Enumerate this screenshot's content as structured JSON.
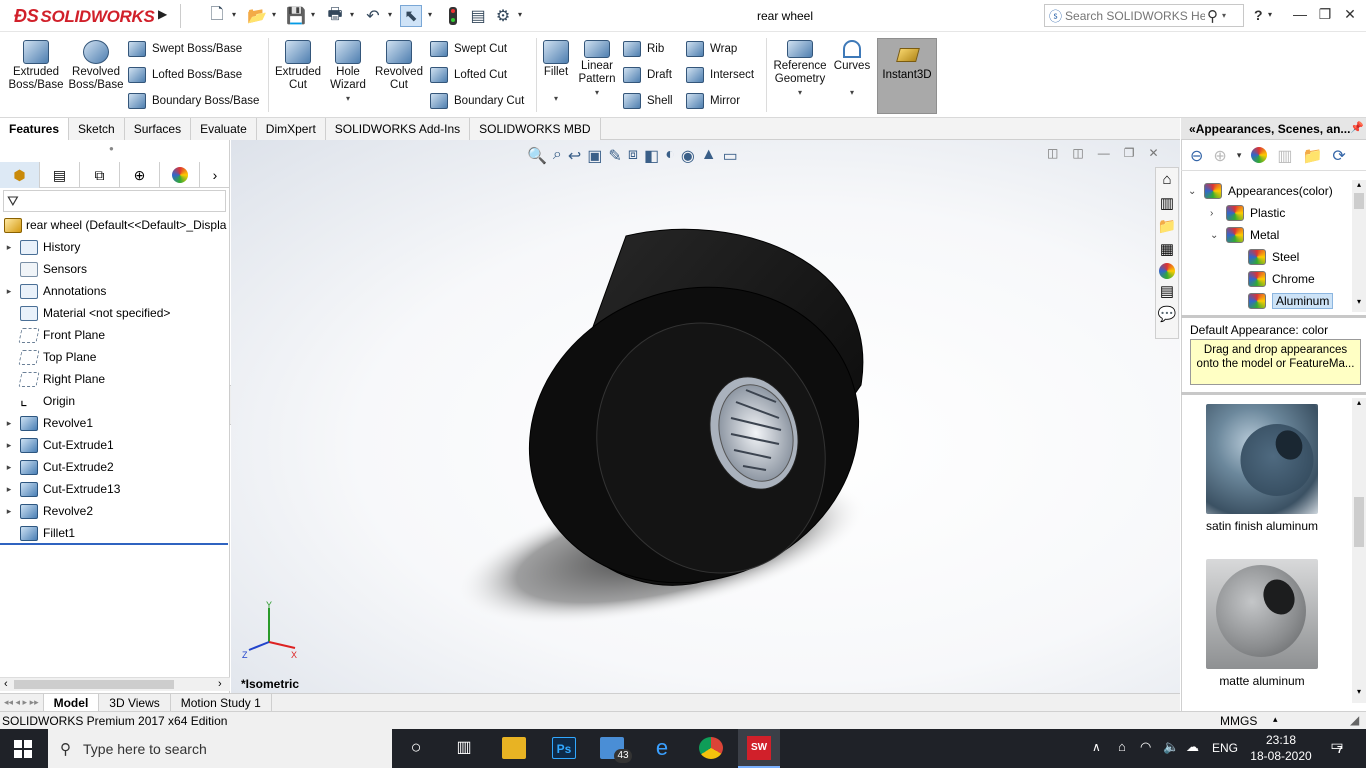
{
  "titlebar": {
    "logo_text": "SOLIDWORKS",
    "document_title": "rear wheel",
    "search_placeholder": "Search SOLIDWORKS Help",
    "help_label": "?"
  },
  "ribbon": {
    "big_buttons": [
      {
        "line1": "Extruded",
        "line2": "Boss/Base"
      },
      {
        "line1": "Revolved",
        "line2": "Boss/Base"
      },
      {
        "line1": "Extruded",
        "line2": "Cut"
      },
      {
        "line1": "Hole",
        "line2": "Wizard"
      },
      {
        "line1": "Revolved",
        "line2": "Cut"
      },
      {
        "line1": "Fillet",
        "line2": ""
      },
      {
        "line1": "Linear",
        "line2": "Pattern"
      },
      {
        "line1": "Reference",
        "line2": "Geometry"
      },
      {
        "line1": "Curves",
        "line2": ""
      }
    ],
    "boss_small": [
      "Swept Boss/Base",
      "Lofted Boss/Base",
      "Boundary Boss/Base"
    ],
    "cut_small": [
      "Swept Cut",
      "Lofted Cut",
      "Boundary Cut"
    ],
    "feature_small_a": [
      "Rib",
      "Draft",
      "Shell"
    ],
    "feature_small_b": [
      "Wrap",
      "Intersect",
      "Mirror"
    ],
    "instant3d": "Instant3D"
  },
  "tabs": [
    "Features",
    "Sketch",
    "Surfaces",
    "Evaluate",
    "DimXpert",
    "SOLIDWORKS Add-Ins",
    "SOLIDWORKS MBD"
  ],
  "feature_tree": {
    "root": "rear wheel  (Default<<Default>_Displa",
    "items": [
      {
        "label": "History",
        "arrow": true,
        "icon": "folder"
      },
      {
        "label": "Sensors",
        "arrow": false,
        "icon": "sensor"
      },
      {
        "label": "Annotations",
        "arrow": true,
        "icon": "folder"
      },
      {
        "label": "Material <not specified>",
        "arrow": false,
        "icon": "material"
      },
      {
        "label": "Front Plane",
        "arrow": false,
        "icon": "plane"
      },
      {
        "label": "Top Plane",
        "arrow": false,
        "icon": "plane"
      },
      {
        "label": "Right Plane",
        "arrow": false,
        "icon": "plane"
      },
      {
        "label": "Origin",
        "arrow": false,
        "icon": "origin"
      },
      {
        "label": "Revolve1",
        "arrow": true,
        "icon": "feature"
      },
      {
        "label": "Cut-Extrude1",
        "arrow": true,
        "icon": "feature"
      },
      {
        "label": "Cut-Extrude2",
        "arrow": true,
        "icon": "feature"
      },
      {
        "label": "Cut-Extrude13",
        "arrow": true,
        "icon": "feature"
      },
      {
        "label": "Revolve2",
        "arrow": true,
        "icon": "feature"
      },
      {
        "label": "Fillet1",
        "arrow": false,
        "icon": "feature"
      }
    ]
  },
  "viewport": {
    "view_name": "*Isometric",
    "triad": {
      "x": "X",
      "y": "Y",
      "z": "Z"
    }
  },
  "bottom_tabs": [
    "Model",
    "3D Views",
    "Motion Study 1"
  ],
  "status": {
    "edition": "SOLIDWORKS Premium 2017 x64 Edition",
    "units": "MMGS"
  },
  "appearances": {
    "header": "Appearances, Scenes, an...",
    "tree": [
      {
        "label": "Appearances(color)",
        "level": 0,
        "arrow": "open"
      },
      {
        "label": "Plastic",
        "level": 1,
        "arrow": "closed"
      },
      {
        "label": "Metal",
        "level": 1,
        "arrow": "open"
      },
      {
        "label": "Steel",
        "level": 2,
        "arrow": "none"
      },
      {
        "label": "Chrome",
        "level": 2,
        "arrow": "none"
      },
      {
        "label": "Aluminum",
        "level": 2,
        "arrow": "none",
        "selected": true
      }
    ],
    "default_label": "Default Appearance: color",
    "tooltip": "Drag and drop appearances onto the model or FeatureMa...",
    "swatches": [
      {
        "label": "satin finish aluminum",
        "color": "#5f7c92"
      },
      {
        "label": "matte aluminum",
        "color": "#9a9c9e"
      }
    ]
  },
  "taskbar": {
    "search_placeholder": "Type here to search",
    "mail_badge": "43",
    "language": "ENG",
    "time": "23:18",
    "date": "18-08-2020",
    "notifications": "7"
  },
  "colors": {
    "brand": "#d1202a",
    "selected_tab": "#dde9f5",
    "instant3d_bg": "#a9a9a9",
    "taskbar": "#1f2228"
  }
}
